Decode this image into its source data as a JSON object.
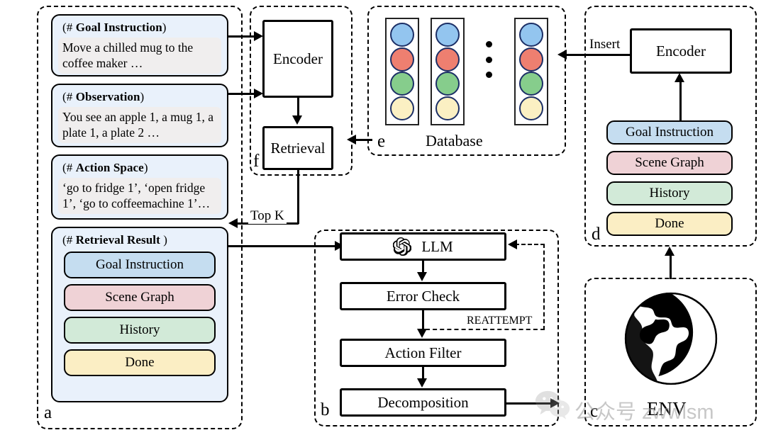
{
  "diagram": {
    "panels": {
      "a": {
        "label": "a"
      },
      "b": {
        "label": "b"
      },
      "c": {
        "label": "c"
      },
      "d": {
        "label": "d"
      },
      "e": {
        "label": "e"
      },
      "f": {
        "label": "f"
      }
    },
    "input_cards": [
      {
        "header_open": "(# ",
        "header_bold": "Goal Instruction",
        "header_close": ")",
        "body": "Move a chilled mug to the coffee maker …"
      },
      {
        "header_open": "(# ",
        "header_bold": "Observation",
        "header_close": ")",
        "body": "You see an apple 1, a mug 1, a plate 1, a plate 2 …"
      },
      {
        "header_open": "(# ",
        "header_bold": "Action Space",
        "header_close": ")",
        "body": "‘go to fridge 1’, ‘open fridge 1’, ‘go to coffeemachine 1’…"
      }
    ],
    "retrieval_card": {
      "header_open": "(# ",
      "header_bold": "Retrieval Result",
      "header_close": " )",
      "chips": [
        {
          "label": "Goal Instruction",
          "color": "#c5ddf0"
        },
        {
          "label": "Scene Graph",
          "color": "#efd2d6"
        },
        {
          "label": "History",
          "color": "#d2ead8"
        },
        {
          "label": "Done",
          "color": "#fbeec4"
        }
      ]
    },
    "encoder_left": {
      "label": "Encoder"
    },
    "retrieval_box": {
      "label": "Retrieval"
    },
    "database": {
      "caption": "Database",
      "columns": [
        {
          "dots": [
            "#93c5ef",
            "#ee7f70",
            "#86cd8c",
            "#fbf0c3"
          ]
        },
        {
          "dots": [
            "#93c5ef",
            "#ee7f70",
            "#86cd8c",
            "#fbf0c3"
          ]
        },
        {
          "dots": [
            "#93c5ef",
            "#ee7f70",
            "#86cd8c",
            "#fbf0c3"
          ]
        }
      ]
    },
    "encoder_right": {
      "label": "Encoder"
    },
    "insert_chips": [
      {
        "label": "Goal Instruction",
        "color": "#c5ddf0"
      },
      {
        "label": "Scene Graph",
        "color": "#efd2d6"
      },
      {
        "label": "History",
        "color": "#d2ead8"
      },
      {
        "label": "Done",
        "color": "#fbeec4"
      }
    ],
    "pipeline": [
      {
        "label": "LLM",
        "icon": "openai-logo"
      },
      {
        "label": "Error Check"
      },
      {
        "label": "Action Filter"
      },
      {
        "label": "Decomposition"
      }
    ],
    "env": {
      "label": "ENV",
      "icon": "globe-icon"
    },
    "edge_labels": {
      "top_k": "Top K",
      "insert": "Insert",
      "reattempt": "REATTEMPT"
    },
    "watermark": {
      "icon": "wechat-icon",
      "text": "公众号 zwwlsm"
    }
  }
}
